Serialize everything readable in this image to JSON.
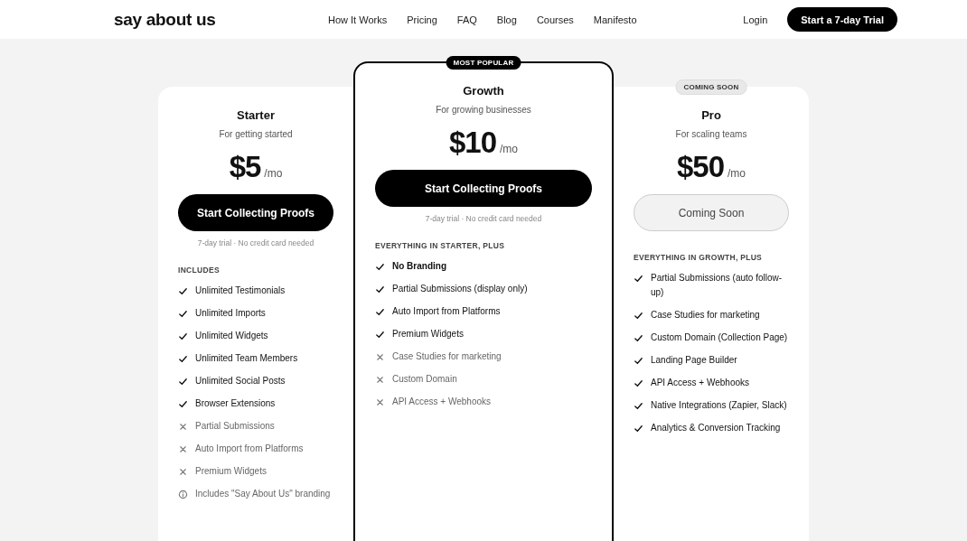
{
  "header": {
    "logo": "say about us",
    "nav": [
      "How It Works",
      "Pricing",
      "FAQ",
      "Blog",
      "Courses",
      "Manifesto"
    ],
    "login": "Login",
    "cta": "Start a 7-day Trial"
  },
  "plans": [
    {
      "name": "Starter",
      "subtitle": "For getting started",
      "price": "$5",
      "period": "/mo",
      "featured": false,
      "button": {
        "label": "Start Collecting Proofs",
        "kind": "primary"
      },
      "note": "7-day trial · No credit card needed",
      "section": "INCLUDES",
      "features": [
        {
          "text": "Unlimited Testimonials",
          "kind": "included",
          "bold": false
        },
        {
          "text": "Unlimited Imports",
          "kind": "included",
          "bold": false
        },
        {
          "text": "Unlimited Widgets",
          "kind": "included",
          "bold": false
        },
        {
          "text": "Unlimited Team Members",
          "kind": "included",
          "bold": false
        },
        {
          "text": "Unlimited Social Posts",
          "kind": "included",
          "bold": false
        },
        {
          "text": "Browser Extensions",
          "kind": "included",
          "bold": false
        },
        {
          "text": "Partial Submissions",
          "kind": "excluded",
          "bold": false
        },
        {
          "text": "Auto Import from Platforms",
          "kind": "excluded",
          "bold": false
        },
        {
          "text": "Premium Widgets",
          "kind": "excluded",
          "bold": false
        },
        {
          "text": "Includes \"Say About Us\" branding",
          "kind": "info",
          "bold": false
        }
      ]
    },
    {
      "name": "Growth",
      "subtitle": "For growing businesses",
      "price": "$10",
      "period": "/mo",
      "featured": true,
      "badge": {
        "text": "MOST POPULAR",
        "kind": "dark"
      },
      "button": {
        "label": "Start Collecting Proofs",
        "kind": "primary"
      },
      "note": "7-day trial · No credit card needed",
      "section": "EVERYTHING IN STARTER, PLUS",
      "features": [
        {
          "text": "No Branding",
          "kind": "included",
          "bold": true
        },
        {
          "text": "Partial Submissions (display only)",
          "kind": "included",
          "bold": false
        },
        {
          "text": "Auto Import from Platforms",
          "kind": "included",
          "bold": false
        },
        {
          "text": "Premium Widgets",
          "kind": "included",
          "bold": false
        },
        {
          "text": "Case Studies for marketing",
          "kind": "excluded",
          "bold": false
        },
        {
          "text": "Custom Domain",
          "kind": "excluded",
          "bold": false
        },
        {
          "text": "API Access + Webhooks",
          "kind": "excluded",
          "bold": false
        }
      ]
    },
    {
      "name": "Pro",
      "subtitle": "For scaling teams",
      "price": "$50",
      "period": "/mo",
      "featured": false,
      "badge": {
        "text": "COMING SOON",
        "kind": "light"
      },
      "button": {
        "label": "Coming Soon",
        "kind": "disabled"
      },
      "section": "EVERYTHING IN GROWTH, PLUS",
      "features": [
        {
          "text": "Partial Submissions (auto follow-up)",
          "kind": "included",
          "bold": false
        },
        {
          "text": "Case Studies for marketing",
          "kind": "included",
          "bold": false
        },
        {
          "text": "Custom Domain (Collection Page)",
          "kind": "included",
          "bold": false
        },
        {
          "text": "Landing Page Builder",
          "kind": "included",
          "bold": false
        },
        {
          "text": "API Access + Webhooks",
          "kind": "included",
          "bold": false
        },
        {
          "text": "Native Integrations (Zapier, Slack)",
          "kind": "included",
          "bold": false
        },
        {
          "text": "Analytics & Conversion Tracking",
          "kind": "included",
          "bold": false
        }
      ]
    }
  ]
}
